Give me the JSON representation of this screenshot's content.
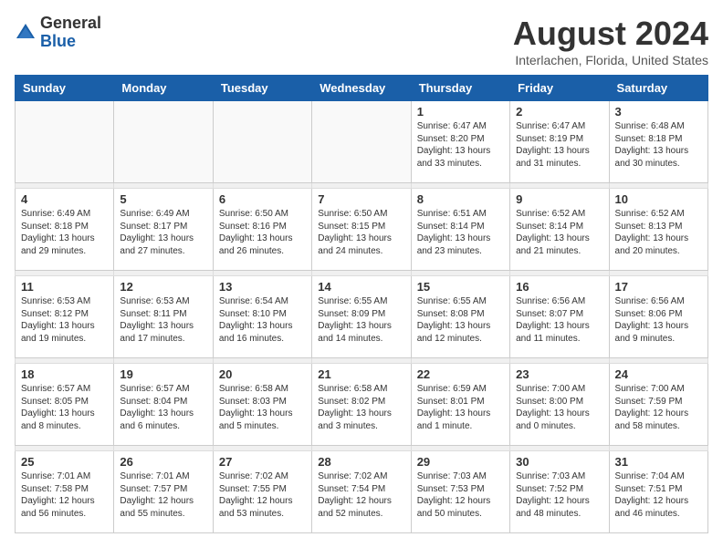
{
  "logo": {
    "general": "General",
    "blue": "Blue"
  },
  "header": {
    "month_year": "August 2024",
    "location": "Interlachen, Florida, United States"
  },
  "days_of_week": [
    "Sunday",
    "Monday",
    "Tuesday",
    "Wednesday",
    "Thursday",
    "Friday",
    "Saturday"
  ],
  "weeks": [
    [
      {
        "day": "",
        "info": ""
      },
      {
        "day": "",
        "info": ""
      },
      {
        "day": "",
        "info": ""
      },
      {
        "day": "",
        "info": ""
      },
      {
        "day": "1",
        "info": "Sunrise: 6:47 AM\nSunset: 8:20 PM\nDaylight: 13 hours\nand 33 minutes."
      },
      {
        "day": "2",
        "info": "Sunrise: 6:47 AM\nSunset: 8:19 PM\nDaylight: 13 hours\nand 31 minutes."
      },
      {
        "day": "3",
        "info": "Sunrise: 6:48 AM\nSunset: 8:18 PM\nDaylight: 13 hours\nand 30 minutes."
      }
    ],
    [
      {
        "day": "4",
        "info": "Sunrise: 6:49 AM\nSunset: 8:18 PM\nDaylight: 13 hours\nand 29 minutes."
      },
      {
        "day": "5",
        "info": "Sunrise: 6:49 AM\nSunset: 8:17 PM\nDaylight: 13 hours\nand 27 minutes."
      },
      {
        "day": "6",
        "info": "Sunrise: 6:50 AM\nSunset: 8:16 PM\nDaylight: 13 hours\nand 26 minutes."
      },
      {
        "day": "7",
        "info": "Sunrise: 6:50 AM\nSunset: 8:15 PM\nDaylight: 13 hours\nand 24 minutes."
      },
      {
        "day": "8",
        "info": "Sunrise: 6:51 AM\nSunset: 8:14 PM\nDaylight: 13 hours\nand 23 minutes."
      },
      {
        "day": "9",
        "info": "Sunrise: 6:52 AM\nSunset: 8:14 PM\nDaylight: 13 hours\nand 21 minutes."
      },
      {
        "day": "10",
        "info": "Sunrise: 6:52 AM\nSunset: 8:13 PM\nDaylight: 13 hours\nand 20 minutes."
      }
    ],
    [
      {
        "day": "11",
        "info": "Sunrise: 6:53 AM\nSunset: 8:12 PM\nDaylight: 13 hours\nand 19 minutes."
      },
      {
        "day": "12",
        "info": "Sunrise: 6:53 AM\nSunset: 8:11 PM\nDaylight: 13 hours\nand 17 minutes."
      },
      {
        "day": "13",
        "info": "Sunrise: 6:54 AM\nSunset: 8:10 PM\nDaylight: 13 hours\nand 16 minutes."
      },
      {
        "day": "14",
        "info": "Sunrise: 6:55 AM\nSunset: 8:09 PM\nDaylight: 13 hours\nand 14 minutes."
      },
      {
        "day": "15",
        "info": "Sunrise: 6:55 AM\nSunset: 8:08 PM\nDaylight: 13 hours\nand 12 minutes."
      },
      {
        "day": "16",
        "info": "Sunrise: 6:56 AM\nSunset: 8:07 PM\nDaylight: 13 hours\nand 11 minutes."
      },
      {
        "day": "17",
        "info": "Sunrise: 6:56 AM\nSunset: 8:06 PM\nDaylight: 13 hours\nand 9 minutes."
      }
    ],
    [
      {
        "day": "18",
        "info": "Sunrise: 6:57 AM\nSunset: 8:05 PM\nDaylight: 13 hours\nand 8 minutes."
      },
      {
        "day": "19",
        "info": "Sunrise: 6:57 AM\nSunset: 8:04 PM\nDaylight: 13 hours\nand 6 minutes."
      },
      {
        "day": "20",
        "info": "Sunrise: 6:58 AM\nSunset: 8:03 PM\nDaylight: 13 hours\nand 5 minutes."
      },
      {
        "day": "21",
        "info": "Sunrise: 6:58 AM\nSunset: 8:02 PM\nDaylight: 13 hours\nand 3 minutes."
      },
      {
        "day": "22",
        "info": "Sunrise: 6:59 AM\nSunset: 8:01 PM\nDaylight: 13 hours\nand 1 minute."
      },
      {
        "day": "23",
        "info": "Sunrise: 7:00 AM\nSunset: 8:00 PM\nDaylight: 13 hours\nand 0 minutes."
      },
      {
        "day": "24",
        "info": "Sunrise: 7:00 AM\nSunset: 7:59 PM\nDaylight: 12 hours\nand 58 minutes."
      }
    ],
    [
      {
        "day": "25",
        "info": "Sunrise: 7:01 AM\nSunset: 7:58 PM\nDaylight: 12 hours\nand 56 minutes."
      },
      {
        "day": "26",
        "info": "Sunrise: 7:01 AM\nSunset: 7:57 PM\nDaylight: 12 hours\nand 55 minutes."
      },
      {
        "day": "27",
        "info": "Sunrise: 7:02 AM\nSunset: 7:55 PM\nDaylight: 12 hours\nand 53 minutes."
      },
      {
        "day": "28",
        "info": "Sunrise: 7:02 AM\nSunset: 7:54 PM\nDaylight: 12 hours\nand 52 minutes."
      },
      {
        "day": "29",
        "info": "Sunrise: 7:03 AM\nSunset: 7:53 PM\nDaylight: 12 hours\nand 50 minutes."
      },
      {
        "day": "30",
        "info": "Sunrise: 7:03 AM\nSunset: 7:52 PM\nDaylight: 12 hours\nand 48 minutes."
      },
      {
        "day": "31",
        "info": "Sunrise: 7:04 AM\nSunset: 7:51 PM\nDaylight: 12 hours\nand 46 minutes."
      }
    ]
  ]
}
